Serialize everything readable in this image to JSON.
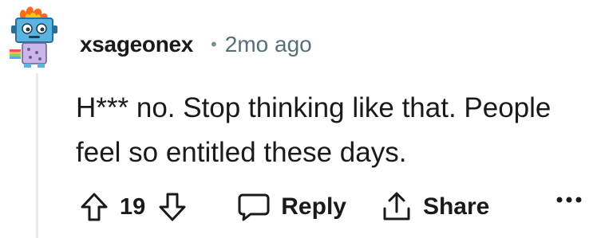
{
  "comment": {
    "username": "xsageonex",
    "separator": "•",
    "timestamp": "2mo ago",
    "body": "H*** no. Stop thinking like that. People feel so entitled these days.",
    "score": "19"
  },
  "actions": {
    "upvote_icon": "arrow-up-icon",
    "downvote_icon": "arrow-down-icon",
    "reply_icon": "speech-bubble-icon",
    "reply_label": "Reply",
    "share_icon": "share-icon",
    "share_label": "Share",
    "more_icon": "ellipsis-icon"
  },
  "colors": {
    "text": "#1a1a1b",
    "meta": "#576f76",
    "thread_line": "#e5ebee",
    "avatar_body": "#5ab4df",
    "avatar_flame": "#ff6a1a"
  }
}
